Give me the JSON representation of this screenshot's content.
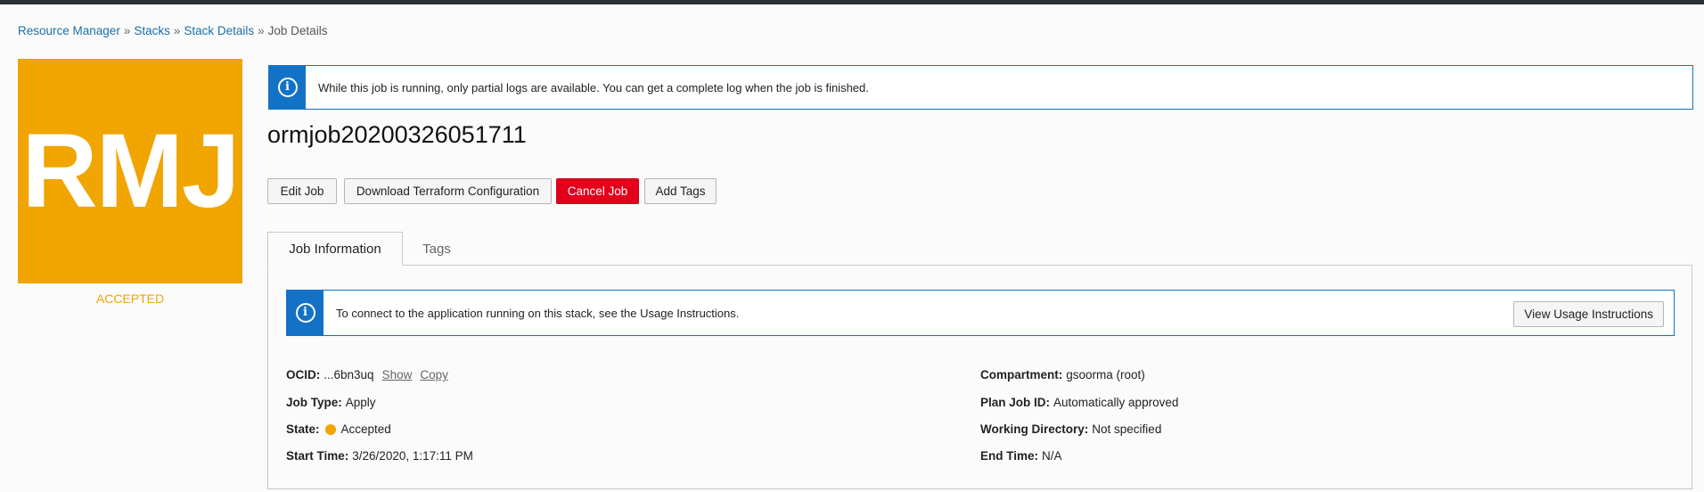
{
  "breadcrumb": {
    "items": [
      "Resource Manager",
      "Stacks",
      "Stack Details"
    ],
    "current": "Job Details",
    "separator": "»"
  },
  "badge": {
    "initials": "RMJ",
    "status": "ACCEPTED",
    "color": "#f0a500"
  },
  "top_alert": {
    "icon": "info-icon",
    "text": "While this job is running, only partial logs are available. You can get a complete log when the job is finished."
  },
  "job": {
    "title": "ormjob20200326051711"
  },
  "actions": {
    "edit": "Edit Job",
    "download": "Download Terraform Configuration",
    "cancel": "Cancel Job",
    "add_tags": "Add Tags"
  },
  "tabs": {
    "active": "Job Information",
    "other": "Tags"
  },
  "usage_alert": {
    "icon": "info-icon",
    "text": "To connect to the application running on this stack, see the Usage Instructions.",
    "button": "View Usage Instructions"
  },
  "details": {
    "ocid_label": "OCID:",
    "ocid_value": "...6bn3uq",
    "show": "Show",
    "copy": "Copy",
    "job_type_label": "Job Type:",
    "job_type_value": "Apply",
    "state_label": "State:",
    "state_value": "Accepted",
    "start_time_label": "Start Time:",
    "start_time_value": "3/26/2020, 1:17:11 PM",
    "compartment_label": "Compartment:",
    "compartment_value": "gsoorma (root)",
    "plan_job_label": "Plan Job ID:",
    "plan_job_value": "Automatically approved",
    "working_dir_label": "Working Directory:",
    "working_dir_value": "Not specified",
    "end_time_label": "End Time:",
    "end_time_value": "N/A"
  },
  "colors": {
    "accent_blue": "#1372c6",
    "link": "#1b6fa8",
    "danger": "#e4001b",
    "accepted": "#f0a500"
  }
}
